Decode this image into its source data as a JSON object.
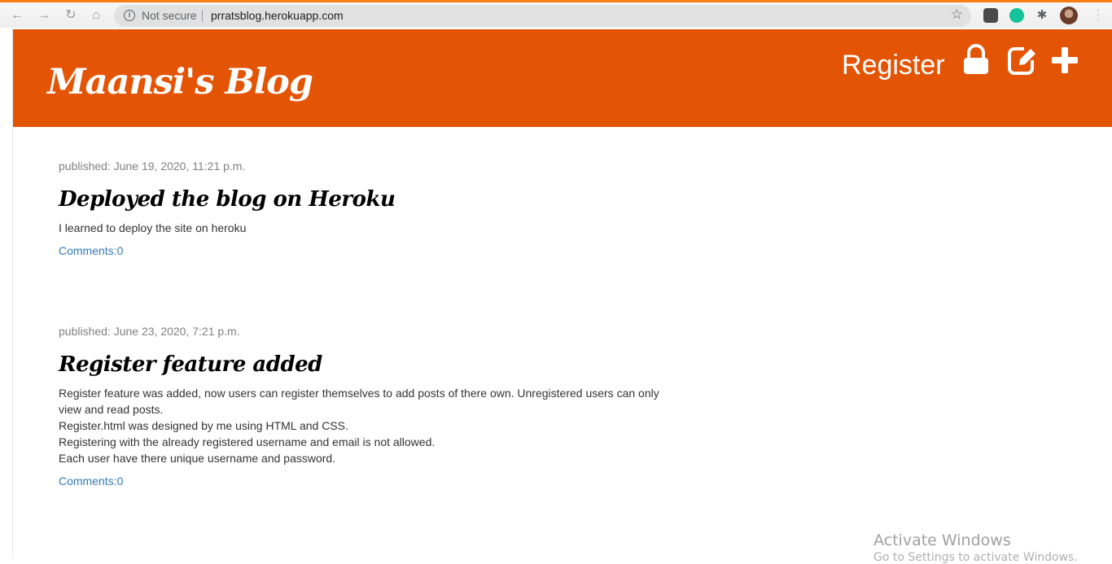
{
  "browser": {
    "security_label": "Not secure",
    "url": "prratsblog.herokuapp.com"
  },
  "header": {
    "blog_title": "Maansi's Blog",
    "register_label": "Register",
    "icons": [
      "lock-icon",
      "edit-icon",
      "plus-icon"
    ],
    "background_color": "#e45405"
  },
  "posts": [
    {
      "published": "published: June 19, 2020, 11:21 p.m.",
      "title": "Deployed the blog on Heroku",
      "body": [
        "I learned to deploy the site on heroku"
      ],
      "comments": "Comments:0"
    },
    {
      "published": "published: June 23, 2020, 7:21 p.m.",
      "title": "Register feature added",
      "body": [
        "Register feature was added, now users can register themselves to add posts of there own. Unregistered users can only view and read posts.",
        "Register.html was designed by me using HTML and CSS.",
        "Registering with the already registered username and email is not allowed.",
        "Each user have there unique username and password."
      ],
      "comments": "Comments:0"
    }
  ],
  "watermark": {
    "line1": "Activate Windows",
    "line2": "Go to Settings to activate Windows."
  },
  "colors": {
    "link": "#337ab7",
    "accent": "#f57d14"
  }
}
